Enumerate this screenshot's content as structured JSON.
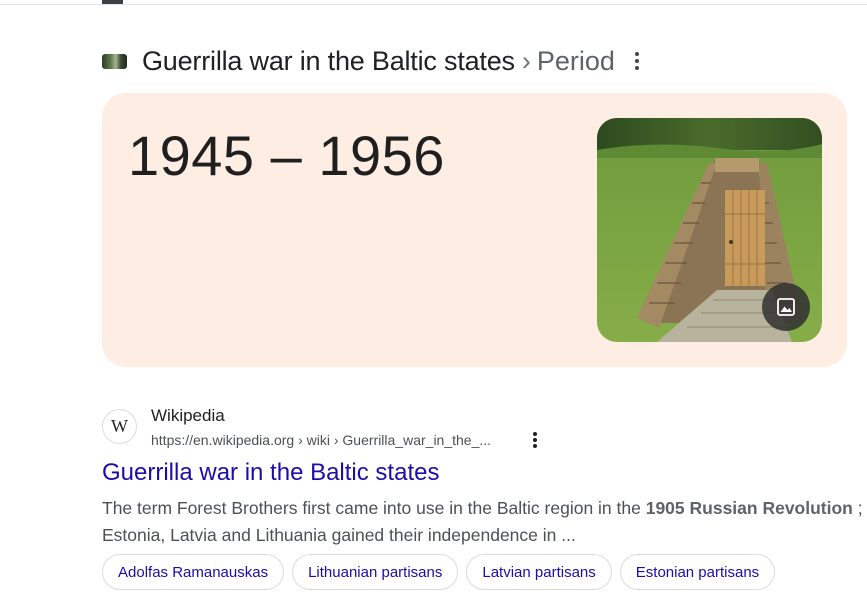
{
  "heading": {
    "title": "Guerrilla war in the Baltic states",
    "separator": "›",
    "subtitle": "Period"
  },
  "answer": {
    "value": "1945 – 1956"
  },
  "result": {
    "favicon_letter": "W",
    "site_name": "Wikipedia",
    "url": "https://en.wikipedia.org › wiki › Guerrilla_war_in_the_...",
    "title": "Guerrilla war in the Baltic states",
    "snippet_before": "The term Forest Brothers first came into use in the Baltic region in the ",
    "snippet_bold": "1905 Russian Revolution",
    "snippet_after": " ; Estonia, Latvia and Lithuania gained their independence in ..."
  },
  "chips": [
    "Adolfas Ramanauskas",
    "Lithuanian partisans",
    "Latvian partisans",
    "Estonian partisans"
  ],
  "icons": {
    "more": "more-vert-icon",
    "image": "image-icon"
  },
  "colors": {
    "answer_card_bg": "#feede2",
    "link": "#1a0dab",
    "snippet": "#4d5156"
  }
}
